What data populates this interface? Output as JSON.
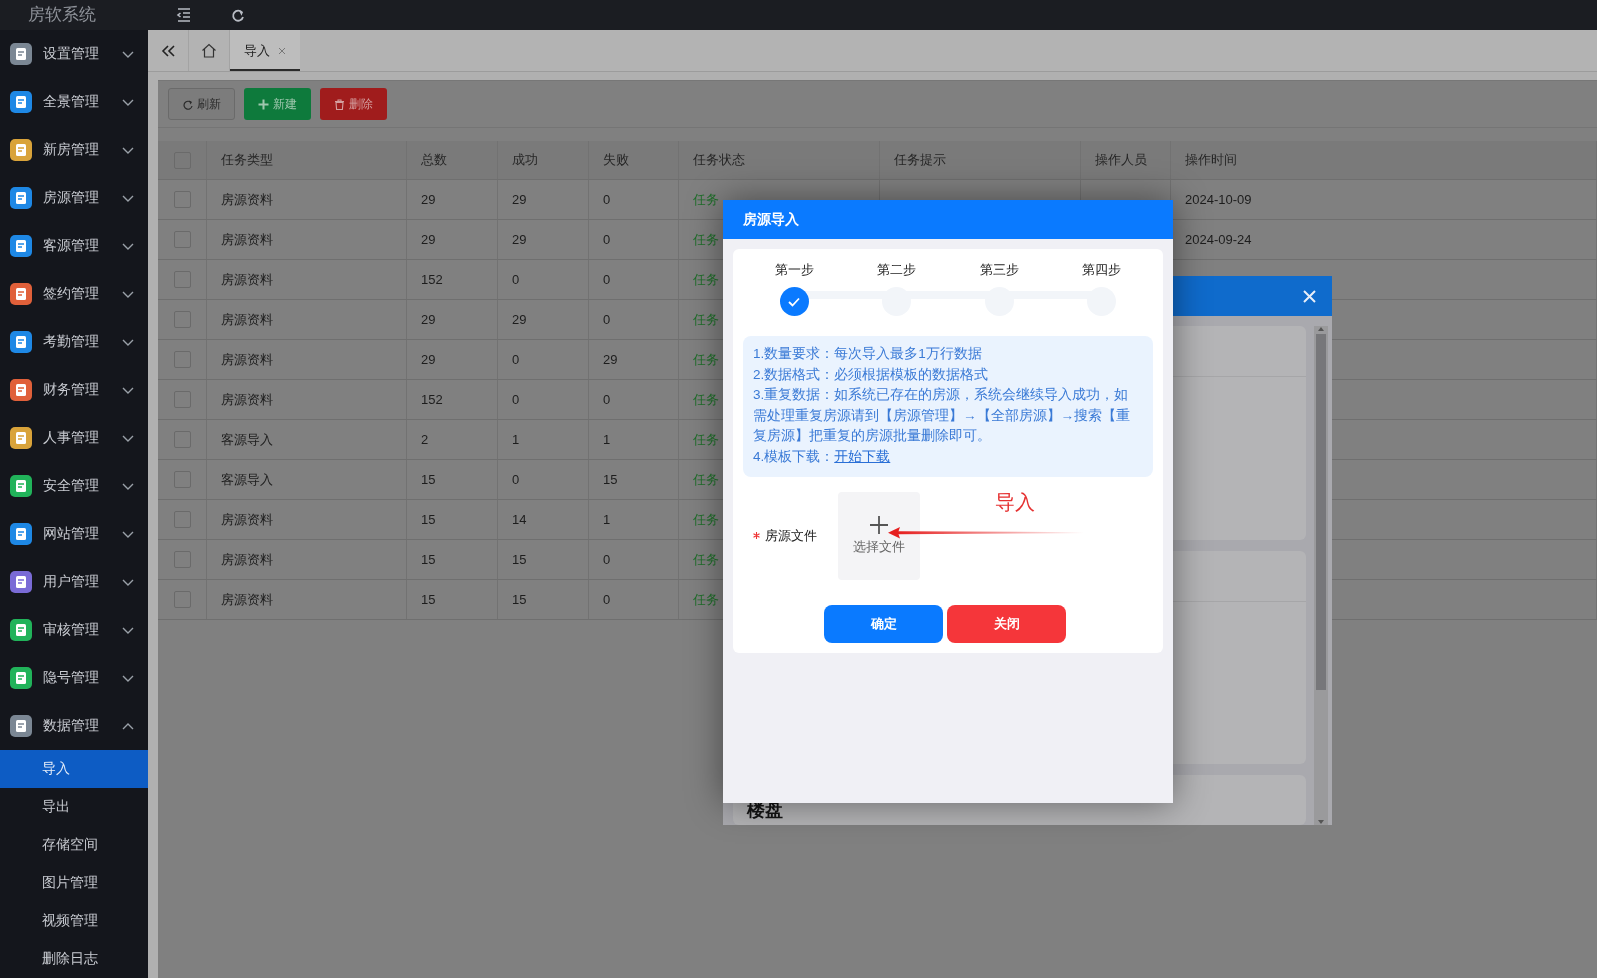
{
  "header": {
    "title": "房软系统"
  },
  "sidebar": {
    "items": [
      {
        "label": "设置管理",
        "color": "#7b8794",
        "expanded": false
      },
      {
        "label": "全景管理",
        "color": "#1e88e5",
        "expanded": false
      },
      {
        "label": "新房管理",
        "color": "#d9a33a",
        "expanded": false
      },
      {
        "label": "房源管理",
        "color": "#1e88e5",
        "expanded": false
      },
      {
        "label": "客源管理",
        "color": "#1e88e5",
        "expanded": false
      },
      {
        "label": "签约管理",
        "color": "#e0603a",
        "expanded": false
      },
      {
        "label": "考勤管理",
        "color": "#1e88e5",
        "expanded": false
      },
      {
        "label": "财务管理",
        "color": "#e0603a",
        "expanded": false
      },
      {
        "label": "人事管理",
        "color": "#d9a33a",
        "expanded": false
      },
      {
        "label": "安全管理",
        "color": "#21b35a",
        "expanded": false
      },
      {
        "label": "网站管理",
        "color": "#1e88e5",
        "expanded": false
      },
      {
        "label": "用户管理",
        "color": "#7a6bd6",
        "expanded": false
      },
      {
        "label": "审核管理",
        "color": "#21b35a",
        "expanded": false
      },
      {
        "label": "隐号管理",
        "color": "#21b35a",
        "expanded": false
      },
      {
        "label": "数据管理",
        "color": "#7b8794",
        "expanded": true,
        "children": [
          {
            "label": "导入",
            "selected": true
          },
          {
            "label": "导出",
            "selected": false
          },
          {
            "label": "存储空间",
            "selected": false
          },
          {
            "label": "图片管理",
            "selected": false
          },
          {
            "label": "视频管理",
            "selected": false
          },
          {
            "label": "删除日志",
            "selected": false
          }
        ]
      }
    ]
  },
  "tabs": [
    {
      "label": "导入",
      "selected": true
    }
  ],
  "toolbar": {
    "buttons": [
      {
        "label": "刷新",
        "kind": "refresh"
      },
      {
        "label": "新建",
        "kind": "create"
      },
      {
        "label": "删除",
        "kind": "delete"
      }
    ]
  },
  "table": {
    "select_all_checked": false,
    "columns": [
      "任务类型",
      "总数",
      "成功",
      "失败",
      "任务状态",
      "任务提示",
      "操作人员",
      "操作时间"
    ],
    "rows": [
      {
        "checked": false,
        "type": "房源资料",
        "total": "29",
        "success": "29",
        "fail": "0",
        "status": "任务",
        "time": "2024-10-09"
      },
      {
        "checked": false,
        "type": "房源资料",
        "total": "29",
        "success": "29",
        "fail": "0",
        "status": "任务",
        "time": "2024-09-24"
      },
      {
        "checked": false,
        "type": "房源资料",
        "total": "152",
        "success": "0",
        "fail": "0",
        "status": "任务"
      },
      {
        "checked": false,
        "type": "房源资料",
        "total": "29",
        "success": "29",
        "fail": "0",
        "status": "任务"
      },
      {
        "checked": false,
        "type": "房源资料",
        "total": "29",
        "success": "0",
        "fail": "29",
        "status": "任务"
      },
      {
        "checked": false,
        "type": "房源资料",
        "total": "152",
        "success": "0",
        "fail": "0",
        "status": "任务"
      },
      {
        "checked": false,
        "type": "客源导入",
        "total": "2",
        "success": "1",
        "fail": "1",
        "status": "任务"
      },
      {
        "checked": false,
        "type": "客源导入",
        "total": "15",
        "success": "0",
        "fail": "15",
        "status": "任务"
      },
      {
        "checked": false,
        "type": "房源资料",
        "total": "15",
        "success": "14",
        "fail": "1",
        "status": "任务"
      },
      {
        "checked": false,
        "type": "房源资料",
        "total": "15",
        "success": "15",
        "fail": "0",
        "status": "任务"
      },
      {
        "checked": false,
        "type": "房源资料",
        "total": "15",
        "success": "15",
        "fail": "0",
        "status": "任务"
      }
    ]
  },
  "back_dialog": {
    "section_title": "楼盘"
  },
  "import_dialog": {
    "title": "房源导入",
    "steps": [
      {
        "label": "第一步",
        "completed": true
      },
      {
        "label": "第二步",
        "completed": false
      },
      {
        "label": "第三步",
        "completed": false
      },
      {
        "label": "第四步",
        "completed": false
      }
    ],
    "notes": [
      {
        "text": "1.数量要求：每次导入最多1万行数据"
      },
      {
        "text": "2.数据格式：必须根据模板的数据格式"
      },
      {
        "text": "3.重复数据：如系统已存在的房源，系统会继续导入成功，如需处理重复房源请到【房源管理】→【全部房源】→搜索【重复房源】把重复的房源批量删除即可。"
      },
      {
        "text": "4.模板下载：",
        "link": "开始下载"
      }
    ],
    "field": {
      "label": "房源文件",
      "required": true,
      "upload_label": "选择文件"
    },
    "annotation": {
      "text": "导入"
    },
    "buttons": [
      {
        "label": "确定",
        "kind": "primary"
      },
      {
        "label": "关闭",
        "kind": "danger"
      }
    ]
  }
}
